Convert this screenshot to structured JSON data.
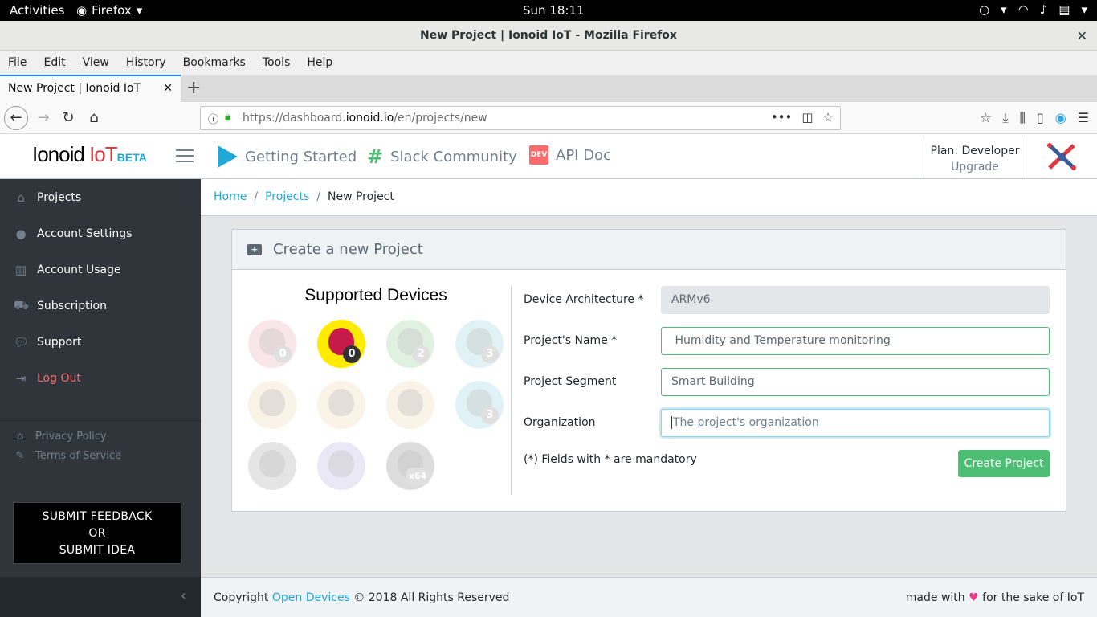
{
  "system": {
    "activities": "Activities",
    "app_name": "Firefox",
    "clock": "Sun 18:11"
  },
  "window": {
    "title": "New Project | Ionoid IoT - Mozilla Firefox"
  },
  "menubar": [
    "File",
    "Edit",
    "View",
    "History",
    "Bookmarks",
    "Tools",
    "Help"
  ],
  "tab": {
    "title": "New Project | Ionoid IoT"
  },
  "url": {
    "prefix": "https://dashboard.",
    "domain": "ionoid.io",
    "path": "/en/projects/new"
  },
  "header": {
    "brand_main": "Ionoid",
    "brand_iot": "IoT",
    "brand_beta": "BETA",
    "nav": [
      {
        "label": "Getting Started",
        "icon": "play-icon"
      },
      {
        "label": "Slack Community",
        "icon": "slack-icon"
      },
      {
        "label": "API Doc",
        "icon": "dev-icon",
        "icon_text": "DEV"
      }
    ],
    "plan_label": "Plan: Developer",
    "upgrade_label": "Upgrade"
  },
  "sidebar": {
    "items": [
      {
        "label": "Projects",
        "icon": "home-icon"
      },
      {
        "label": "Account Settings",
        "icon": "user-icon"
      },
      {
        "label": "Account Usage",
        "icon": "chart-icon"
      },
      {
        "label": "Subscription",
        "icon": "cart-icon"
      },
      {
        "label": "Support",
        "icon": "comment-icon"
      },
      {
        "label": "Log Out",
        "icon": "logout-icon"
      }
    ],
    "privacy": "Privacy Policy",
    "terms": "Terms of Service",
    "feedback_line1": "SUBMIT FEEDBACK",
    "feedback_line2": "OR",
    "feedback_line3": "SUBMIT IDEA"
  },
  "breadcrumb": {
    "home": "Home",
    "projects": "Projects",
    "current": "New Project"
  },
  "card": {
    "title": "Create a new Project",
    "devices_title": "Supported Devices",
    "devices": [
      {
        "name": "raspberry-pi-zero",
        "badge": "0",
        "active": false,
        "color": "#e8a0b4"
      },
      {
        "name": "raspberry-pi-zero-w",
        "badge": "0",
        "active": true,
        "color": "#ffeb00"
      },
      {
        "name": "raspberry-pi-2",
        "badge": "2",
        "active": false,
        "color": "#8cc88c"
      },
      {
        "name": "raspberry-pi-3",
        "badge": "3",
        "active": false,
        "color": "#8ccde0"
      },
      {
        "name": "beaglebone-black",
        "badge": "",
        "active": false,
        "color": "#e8d0a8"
      },
      {
        "name": "beaglebone-white",
        "badge": "",
        "active": false,
        "color": "#e8d0a8"
      },
      {
        "name": "beaglebone-green",
        "badge": "",
        "active": false,
        "color": "#e8d0a8"
      },
      {
        "name": "raspberry-pi-3-plus",
        "badge": "3",
        "active": false,
        "color": "#8ccde0"
      },
      {
        "name": "linux-arm",
        "badge": "",
        "active": false,
        "color": "#9a9a9a"
      },
      {
        "name": "intel",
        "badge": "",
        "active": false,
        "color": "#b0a8d8"
      },
      {
        "name": "linux-x64",
        "badge": "x64",
        "active": false,
        "color": "#7a7a7a"
      }
    ],
    "form": {
      "arch_label": "Device Architecture *",
      "arch_value": "ARMv6",
      "name_label": "Project's Name *",
      "name_value": " Humidity and Temperature monitoring",
      "segment_label": "Project Segment",
      "segment_value": "Smart Building",
      "org_label": "Organization",
      "org_placeholder": "The project's organization",
      "note": "(*) Fields with * are mandatory",
      "create_button": "Create Project"
    }
  },
  "footer": {
    "copyright_prefix": "Copyright ",
    "company": "Open Devices",
    "copyright_suffix": " © 2018 All Rights Reserved",
    "made_prefix": "made with ",
    "made_suffix": " for the sake of IoT"
  },
  "colors": {
    "accent": "#20a8d8",
    "success": "#4dbd74",
    "danger": "#f86c6b",
    "sidebar": "#2f353a"
  }
}
